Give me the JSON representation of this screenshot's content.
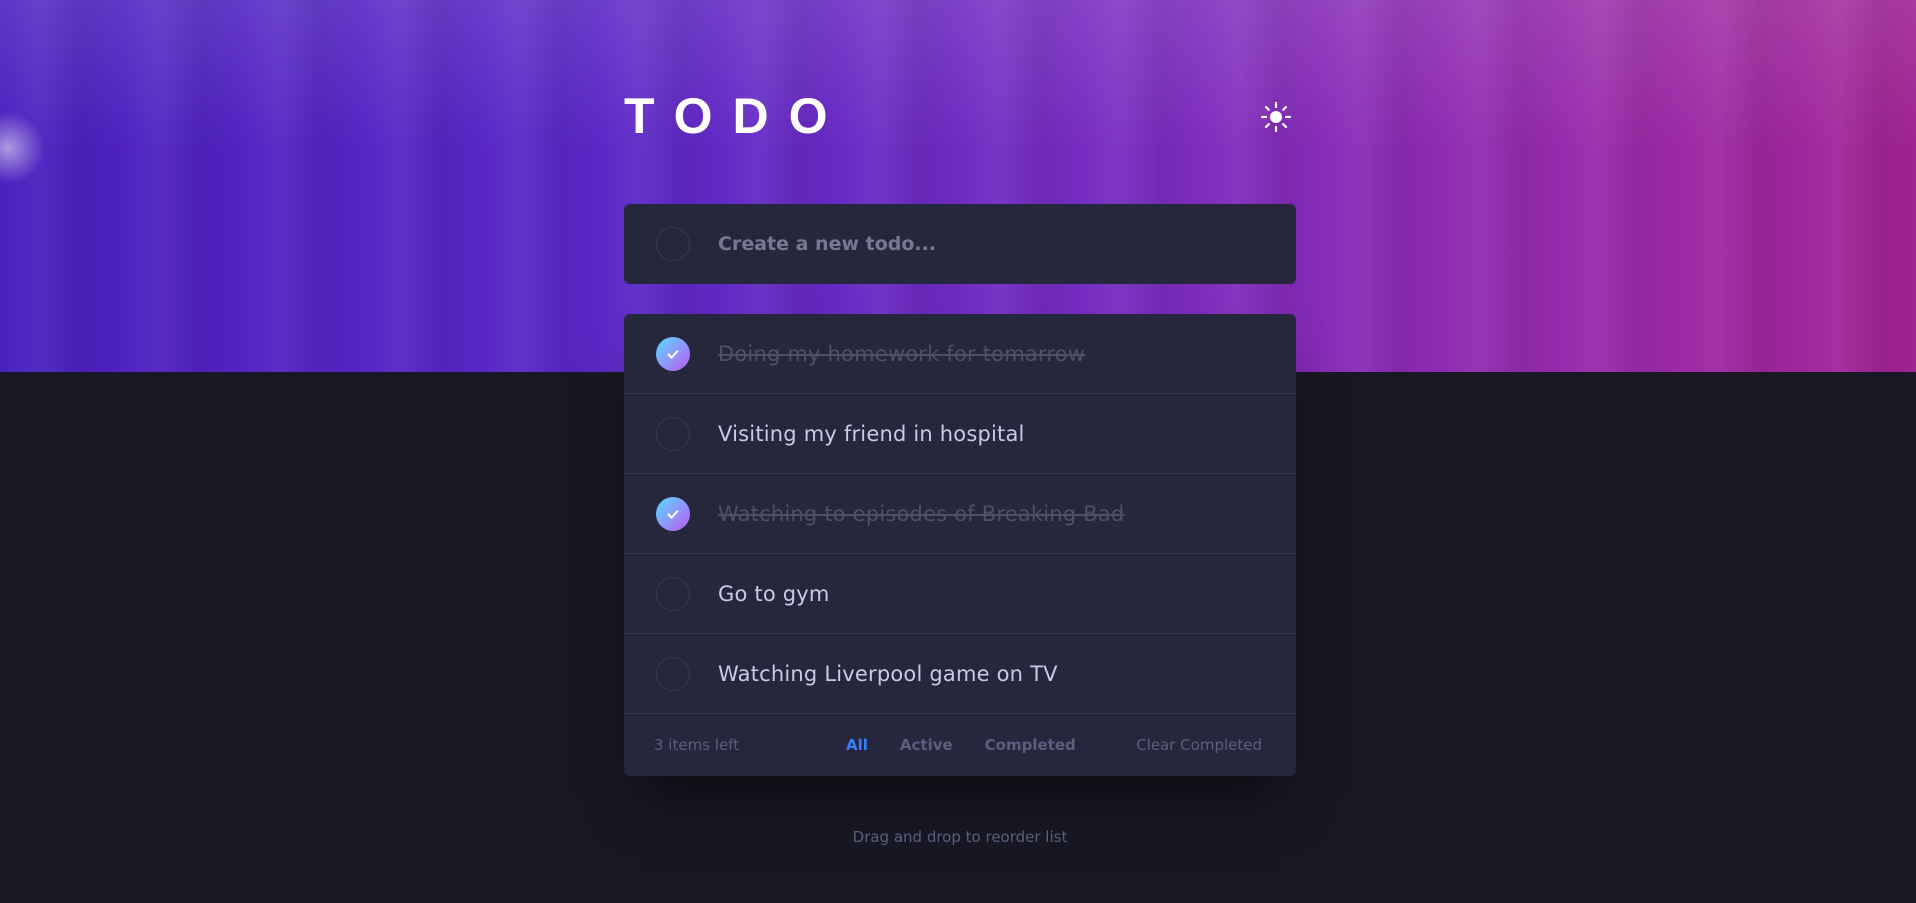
{
  "app": {
    "title": "TODO"
  },
  "new_todo": {
    "placeholder": "Create a new todo..."
  },
  "todos": [
    {
      "text": "Doing my homework for tomarrow",
      "completed": true
    },
    {
      "text": "Visiting my friend in hospital",
      "completed": false
    },
    {
      "text": "Watching to episodes of Breaking Bad",
      "completed": true
    },
    {
      "text": "Go to gym",
      "completed": false
    },
    {
      "text": "Watching Liverpool game on TV",
      "completed": false
    }
  ],
  "footer": {
    "items_left": "3 items left",
    "filters": [
      "All",
      "Active",
      "Completed"
    ],
    "active_filter": "All",
    "clear_label": "Clear Completed"
  },
  "hint": "Drag and drop to reorder list",
  "icons": {
    "theme_toggle": "sun-icon",
    "check": "check-icon"
  },
  "colors": {
    "background": "#171823",
    "card": "#25273d",
    "accent": "#3a7cfd",
    "check_gradient_start": "#55ddff",
    "check_gradient_end": "#c058f3"
  }
}
